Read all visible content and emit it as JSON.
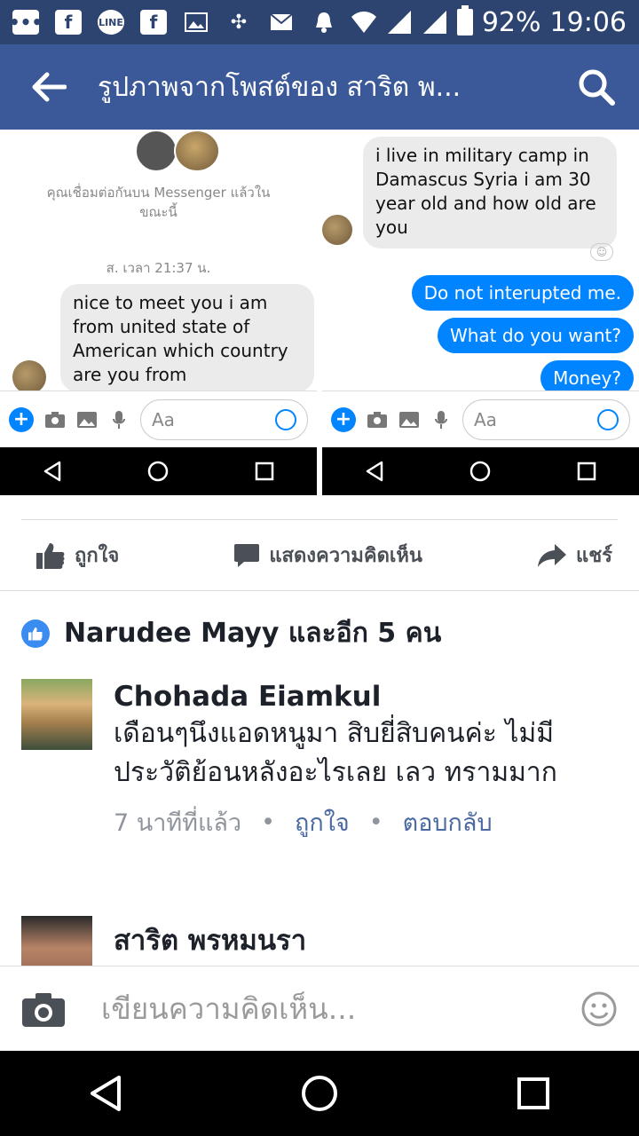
{
  "status_bar": {
    "battery": "92%",
    "time": "19:06",
    "icons": [
      "chat-icon",
      "facebook-icon",
      "line-icon",
      "facebook-icon",
      "image-icon",
      "pinwheel-icon",
      "mail-icon",
      "bell-icon",
      "wifi-icon",
      "signal-icon",
      "signal-icon",
      "battery-icon"
    ]
  },
  "app_bar": {
    "title": "รูปภาพจากโพสต์ของ สาริต พ...",
    "back_icon": "arrow-left-icon",
    "search_icon": "search-icon"
  },
  "photo": {
    "left": {
      "connected_text": "คุณเชื่อมต่อกันบน Messenger แล้วในขณะนี้",
      "timestamp": "ส. เวลา 21:37 น.",
      "message": "nice to meet you i am from united state of American which country are you from",
      "composer_placeholder": "Aa"
    },
    "right": {
      "message_in": "i live in military camp in Damascus Syria  i am 30 year old and how old are you",
      "messages_out": [
        "Do not interupted me.",
        "What do you want?",
        "Money?"
      ],
      "composer_placeholder": "Aa"
    }
  },
  "actions": {
    "like": "ถูกใจ",
    "comment": "แสดงความคิดเห็น",
    "share": "แชร์"
  },
  "likes_summary": "Narudee Mayy และอีก 5 คน",
  "comments": [
    {
      "name": "Chohada Eiamkul",
      "text": "เดือนๆนึงแอดหนูมา สิบยี่สิบคนค่ะ ไม่มีประวัติย้อนหลังอะไรเลย เลว ทรามมาก",
      "time": "7 นาทีที่แล้ว",
      "like": "ถูกใจ",
      "reply": "ตอบกลับ"
    },
    {
      "name": "สาริต พรหมนรา"
    }
  ],
  "composer": {
    "placeholder": "เขียนความคิดเห็น..."
  },
  "colors": {
    "status_bar": "#2d4470",
    "app_bar": "#3b5998",
    "messenger_blue": "#0084ff"
  }
}
